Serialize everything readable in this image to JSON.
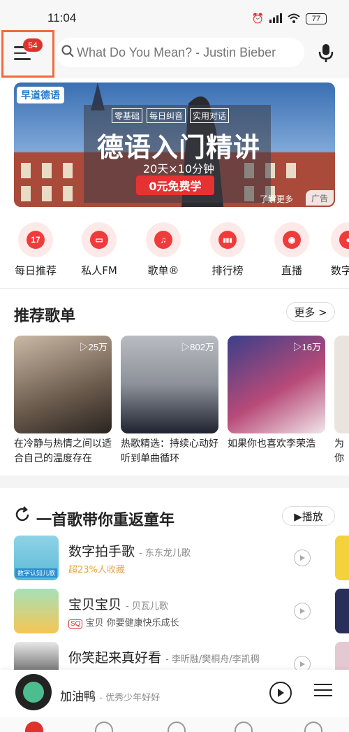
{
  "status": {
    "time": "11:04",
    "battery": "77"
  },
  "header": {
    "menu_badge": "54",
    "search_placeholder": "What Do You Mean? - Justin Bieber"
  },
  "banner": {
    "brand": "早道德语",
    "tags": [
      "零基础",
      "每日纠音",
      "实用对话"
    ],
    "title": "德语入门精讲",
    "subtitle": "20天×10分钟",
    "cta": "0元免费学",
    "more": "了解更多",
    "ad_label": "广告"
  },
  "quick_nav": [
    {
      "label": "每日推荐",
      "icon": "calendar-icon",
      "glyph": "17"
    },
    {
      "label": "私人FM",
      "icon": "radio-icon",
      "glyph": "▭"
    },
    {
      "label": "歌单®",
      "icon": "playlist-icon",
      "glyph": "♫"
    },
    {
      "label": "排行榜",
      "icon": "chart-icon",
      "glyph": "▮▮▮"
    },
    {
      "label": "直播",
      "icon": "live-icon",
      "glyph": "◉"
    },
    {
      "label": "数字",
      "icon": "digital-icon",
      "glyph": "●"
    }
  ],
  "recommend": {
    "title": "推荐歌单",
    "more": "更多 >",
    "cards": [
      {
        "title": "在冷静与热情之间以适合自己的温度存在",
        "plays": "▷25万"
      },
      {
        "title": "热歌精选：持续心动好听到单曲循环",
        "plays": "▷802万"
      },
      {
        "title": "如果你也喜欢李荣浩",
        "plays": "▷16万"
      },
      {
        "title": "为你",
        "plays": ""
      }
    ]
  },
  "song_section": {
    "title": "一首歌带你重返童年",
    "play_all": "▶播放",
    "songs": [
      {
        "title": "数字拍手歌",
        "artist": "- 东东龙儿歌",
        "sub": "超23%人收藏",
        "sq": false,
        "cover_text": "数字认知儿歌"
      },
      {
        "title": "宝贝宝贝",
        "artist": "- 贝瓦儿歌",
        "sub": "宝贝 你要健康快乐成长",
        "sq": true,
        "sq_label": "SQ",
        "cover_text": ""
      },
      {
        "title": "你笑起来真好看",
        "artist": "- 李昕融/樊桐舟/李凯稠",
        "sub": "",
        "sq": false,
        "cover_text": ""
      }
    ]
  },
  "mini_player": {
    "title": "加油鸭",
    "artist": "- 优秀少年好好"
  },
  "colors": {
    "accent": "#e0312c",
    "highlight_box": "#ef6b3c"
  }
}
